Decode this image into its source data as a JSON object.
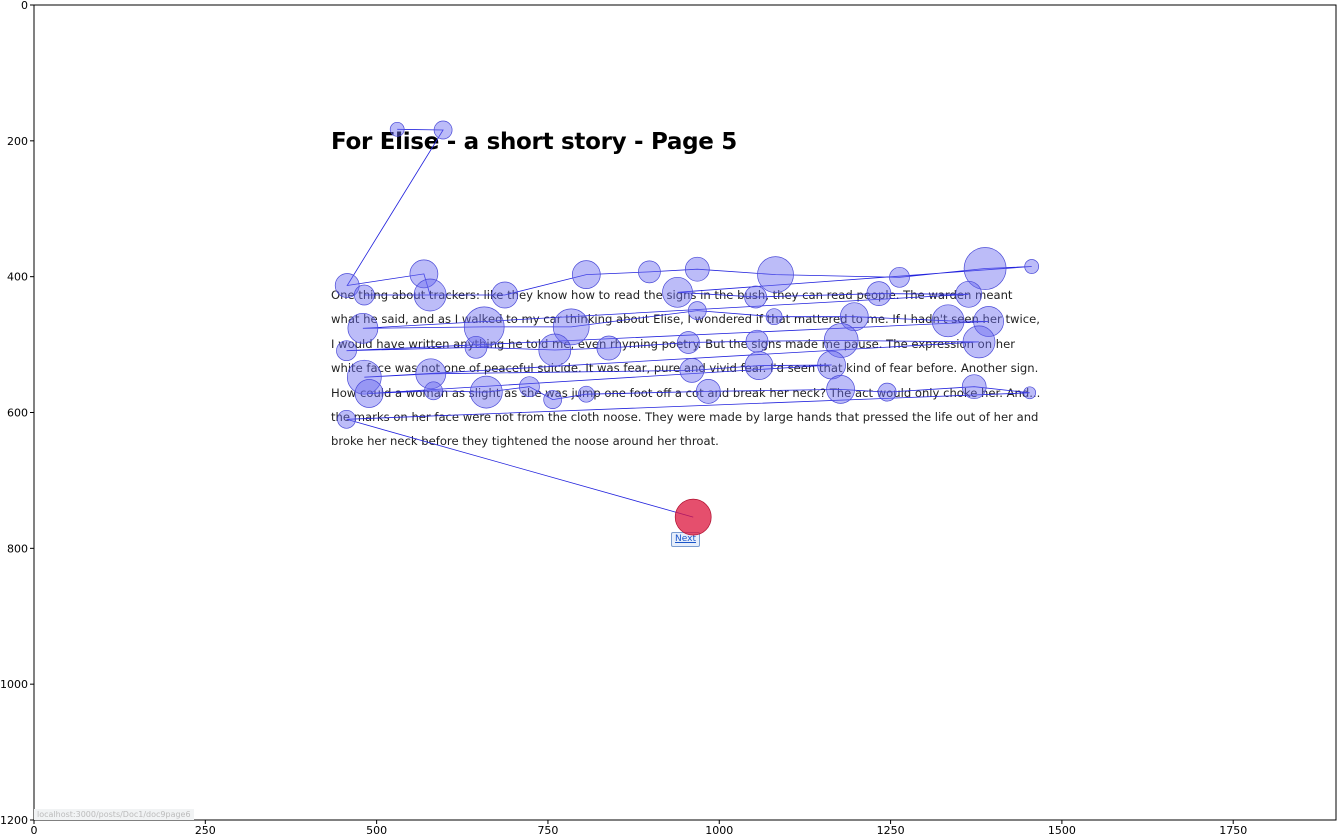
{
  "document": {
    "title": "For Elise - a short story - Page 5",
    "body": "One thing about trackers: like they know how to read the signs in the bush, they can read people. The warden meant what he said, and as I walked to my car thinking about Elise, I wondered if that mattered to me. If I hadn't seen her twice, I would have written anything he told me, even rhyming poetry. But the signs made me pause. The expression on her white face was not one of peaceful suicide. It was fear, pure and vivid fear. I'd seen that kind of fear before. Another sign. How could a woman as slight as she was jump one foot off a cot and break her neck? The act would only choke her. And... the marks on her face were not from the cloth noose. They were made by large hands that pressed the life out of her and broke her neck before they tightened the noose around her throat.",
    "next_label": "Next",
    "status_url": "localhost:3000/posts/Doc1/doc9page6"
  },
  "chart_data": {
    "type": "scatter",
    "xlim": [
      0,
      1900
    ],
    "ylim": [
      1200,
      0
    ],
    "x_ticks": [
      "0",
      "250",
      "500",
      "750",
      "1000",
      "1250",
      "1500",
      "1750"
    ],
    "y_ticks": [
      "0",
      "200",
      "400",
      "600",
      "800",
      "1000",
      "1200"
    ],
    "fixation_color": "#6b6bf0",
    "final_fixation_color": "#dc143c",
    "scanpath_color": "#2222dd",
    "fixations": [
      {
        "x": 530,
        "y": 183,
        "r": 7
      },
      {
        "x": 597,
        "y": 184,
        "r": 9
      },
      {
        "x": 457,
        "y": 413,
        "r": 12
      },
      {
        "x": 569,
        "y": 396,
        "r": 14
      },
      {
        "x": 578,
        "y": 427,
        "r": 16
      },
      {
        "x": 482,
        "y": 427,
        "r": 10
      },
      {
        "x": 687,
        "y": 427,
        "r": 13
      },
      {
        "x": 806,
        "y": 397,
        "r": 14
      },
      {
        "x": 898,
        "y": 393,
        "r": 11
      },
      {
        "x": 968,
        "y": 389,
        "r": 12
      },
      {
        "x": 1082,
        "y": 397,
        "r": 18
      },
      {
        "x": 1263,
        "y": 401,
        "r": 10
      },
      {
        "x": 1388,
        "y": 388,
        "r": 21
      },
      {
        "x": 1456,
        "y": 385,
        "r": 7
      },
      {
        "x": 939,
        "y": 423,
        "r": 15
      },
      {
        "x": 1053,
        "y": 430,
        "r": 11
      },
      {
        "x": 1233,
        "y": 425,
        "r": 12
      },
      {
        "x": 1364,
        "y": 426,
        "r": 13
      },
      {
        "x": 480,
        "y": 476,
        "r": 15
      },
      {
        "x": 657,
        "y": 474,
        "r": 20
      },
      {
        "x": 784,
        "y": 474,
        "r": 18
      },
      {
        "x": 968,
        "y": 450,
        "r": 9
      },
      {
        "x": 1080,
        "y": 459,
        "r": 8
      },
      {
        "x": 1197,
        "y": 459,
        "r": 14
      },
      {
        "x": 1334,
        "y": 465,
        "r": 16
      },
      {
        "x": 1393,
        "y": 466,
        "r": 15
      },
      {
        "x": 456,
        "y": 509,
        "r": 10
      },
      {
        "x": 645,
        "y": 504,
        "r": 11
      },
      {
        "x": 760,
        "y": 508,
        "r": 16
      },
      {
        "x": 839,
        "y": 505,
        "r": 12
      },
      {
        "x": 955,
        "y": 497,
        "r": 11
      },
      {
        "x": 1055,
        "y": 495,
        "r": 11
      },
      {
        "x": 1178,
        "y": 494,
        "r": 17
      },
      {
        "x": 1379,
        "y": 496,
        "r": 16
      },
      {
        "x": 482,
        "y": 548,
        "r": 17
      },
      {
        "x": 579,
        "y": 543,
        "r": 15
      },
      {
        "x": 960,
        "y": 538,
        "r": 12
      },
      {
        "x": 1058,
        "y": 531,
        "r": 14
      },
      {
        "x": 1164,
        "y": 530,
        "r": 14
      },
      {
        "x": 489,
        "y": 572,
        "r": 14
      },
      {
        "x": 583,
        "y": 568,
        "r": 9
      },
      {
        "x": 660,
        "y": 570,
        "r": 16
      },
      {
        "x": 723,
        "y": 562,
        "r": 10
      },
      {
        "x": 757,
        "y": 581,
        "r": 9
      },
      {
        "x": 806,
        "y": 573,
        "r": 8
      },
      {
        "x": 984,
        "y": 569,
        "r": 12
      },
      {
        "x": 1177,
        "y": 566,
        "r": 14
      },
      {
        "x": 1245,
        "y": 570,
        "r": 9
      },
      {
        "x": 1372,
        "y": 562,
        "r": 12
      },
      {
        "x": 1453,
        "y": 571,
        "r": 6
      },
      {
        "x": 456,
        "y": 610,
        "r": 9
      },
      {
        "x": 962,
        "y": 754,
        "r": 18,
        "final": true
      }
    ]
  }
}
